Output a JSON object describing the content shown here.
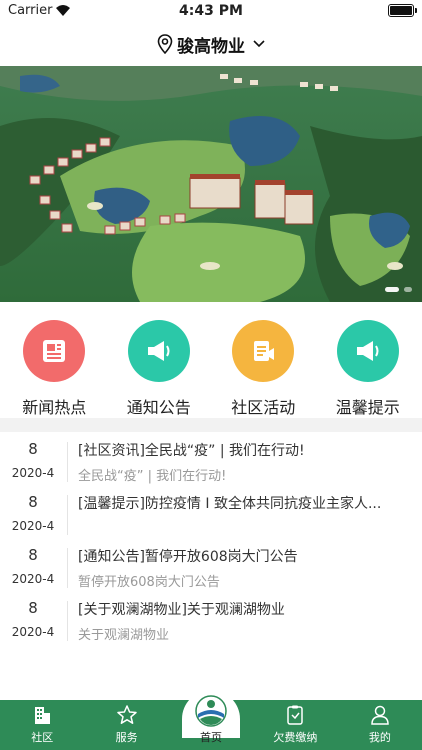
{
  "status_bar": {
    "carrier": "Carrier",
    "time": "4:43 PM"
  },
  "header": {
    "title": "骏高物业"
  },
  "quick_menu": [
    {
      "label": "新闻热点",
      "icon": "newspaper-icon",
      "color": "#f26b6b"
    },
    {
      "label": "通知公告",
      "icon": "megaphone-icon",
      "color": "#2bc8a8"
    },
    {
      "label": "社区活动",
      "icon": "activity-doc-icon",
      "color": "#f5b53f"
    },
    {
      "label": "温馨提示",
      "icon": "megaphone-icon",
      "color": "#2bc8a8"
    }
  ],
  "news": [
    {
      "day": "8",
      "month": "2020-4",
      "title": "[社区资讯]全民战“疫” | 我们在行动!",
      "subtitle": "全民战“疫” | 我们在行动!"
    },
    {
      "day": "8",
      "month": "2020-4",
      "title": "[温馨提示]防控疫情 I 致全体共同抗疫业主家人...",
      "subtitle": ""
    },
    {
      "day": "8",
      "month": "2020-4",
      "title": "[通知公告]暂停开放608岗大门公告",
      "subtitle": "暂停开放608岗大门公告"
    },
    {
      "day": "8",
      "month": "2020-4",
      "title": "[关于观澜湖物业]关于观澜湖物业",
      "subtitle": "关于观澜湖物业"
    }
  ],
  "tabbar": {
    "community": "社区",
    "service": "服务",
    "home": "首页",
    "payment": "欠费缴纳",
    "mine": "我的"
  },
  "colors": {
    "brand_green": "#2e8b57"
  }
}
